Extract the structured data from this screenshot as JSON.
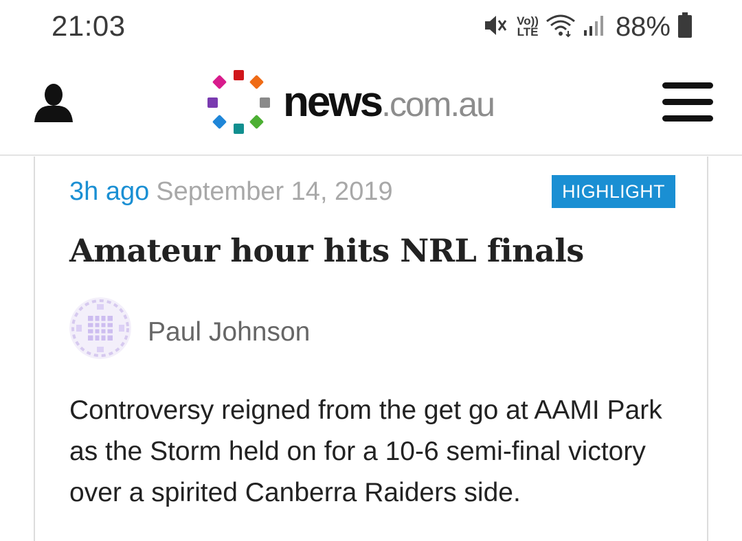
{
  "status_bar": {
    "time": "21:03",
    "network_label": "Vo)) LTE",
    "battery": "88%",
    "icons": [
      "mute-icon",
      "volte-icon",
      "wifi-icon",
      "signal-icon",
      "battery-icon"
    ]
  },
  "header": {
    "logo_news": "news",
    "logo_domain": ".com.au",
    "icons": [
      "profile-icon",
      "menu-icon"
    ],
    "logo_colors": [
      "#d0161b",
      "#ef6b16",
      "#8a8a8a",
      "#4caf33",
      "#118f8f",
      "#1f86d8",
      "#7a3bb0",
      "#d81b8c"
    ]
  },
  "article": {
    "time_ago": "3h ago",
    "date": "September 14, 2019",
    "badge": "HIGHLIGHT",
    "headline": "Amateur hour hits NRL finals",
    "author": "Paul Johnson",
    "summary": "Controversy reigned from the get go at AAMI Park as the Storm held on for a 10-6 semi-final victory over a spirited Canberra Raiders side."
  },
  "colors": {
    "accent": "#1a8fd3",
    "muted": "#a8a8a8",
    "text": "#222222"
  }
}
